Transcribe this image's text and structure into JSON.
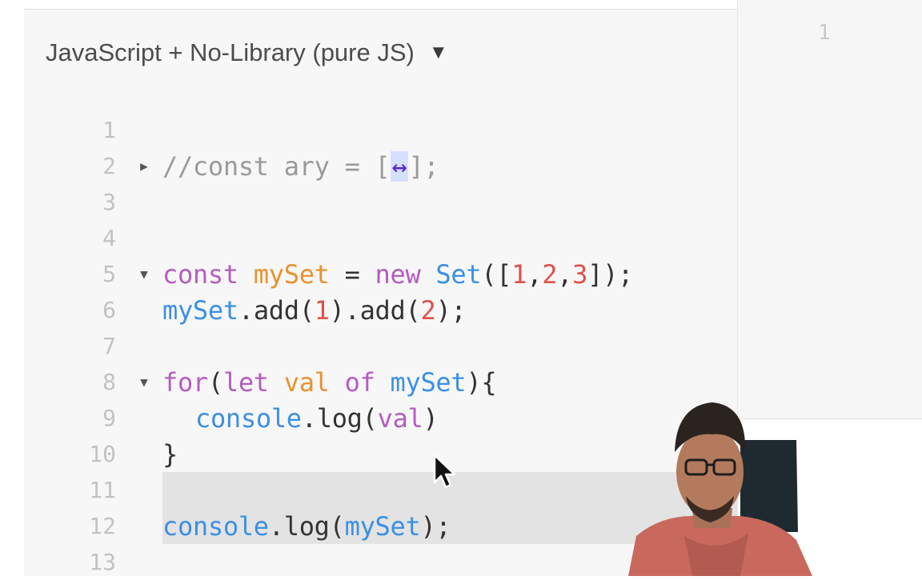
{
  "language_selector": {
    "label": "JavaScript + No-Library (pure JS)"
  },
  "editor": {
    "lines": [
      {
        "n": "1",
        "fold": "",
        "tokens": []
      },
      {
        "n": "2",
        "fold": "right",
        "tokens": [
          {
            "t": "//const ary = [",
            "c": "c"
          },
          {
            "t": "↔",
            "c": "blue-arrows"
          },
          {
            "t": "];",
            "c": "c"
          }
        ]
      },
      {
        "n": "3",
        "fold": "",
        "tokens": []
      },
      {
        "n": "4",
        "fold": "",
        "tokens": []
      },
      {
        "n": "5",
        "fold": "down",
        "tokens": [
          {
            "t": "const ",
            "c": "k"
          },
          {
            "t": "mySet",
            "c": "v"
          },
          {
            "t": " = ",
            "c": "p"
          },
          {
            "t": "new ",
            "c": "k"
          },
          {
            "t": "Set",
            "c": "fn"
          },
          {
            "t": "([",
            "c": "p"
          },
          {
            "t": "1",
            "c": "n"
          },
          {
            "t": ",",
            "c": "p"
          },
          {
            "t": "2",
            "c": "n"
          },
          {
            "t": ",",
            "c": "p"
          },
          {
            "t": "3",
            "c": "n"
          },
          {
            "t": "]);",
            "c": "p"
          }
        ]
      },
      {
        "n": "6",
        "fold": "",
        "tokens": [
          {
            "t": "mySet",
            "c": "fn"
          },
          {
            "t": ".",
            "c": "p"
          },
          {
            "t": "add",
            "c": "p"
          },
          {
            "t": "(",
            "c": "p"
          },
          {
            "t": "1",
            "c": "n"
          },
          {
            "t": ").",
            "c": "p"
          },
          {
            "t": "add",
            "c": "p"
          },
          {
            "t": "(",
            "c": "p"
          },
          {
            "t": "2",
            "c": "n"
          },
          {
            "t": ");",
            "c": "p"
          }
        ]
      },
      {
        "n": "7",
        "fold": "",
        "tokens": []
      },
      {
        "n": "8",
        "fold": "down",
        "tokens": [
          {
            "t": "for",
            "c": "k"
          },
          {
            "t": "(",
            "c": "p"
          },
          {
            "t": "let ",
            "c": "k"
          },
          {
            "t": "val ",
            "c": "v"
          },
          {
            "t": "of ",
            "c": "k"
          },
          {
            "t": "mySet",
            "c": "fn"
          },
          {
            "t": "){",
            "c": "p"
          }
        ]
      },
      {
        "n": "9",
        "fold": "",
        "indent": true,
        "tokens": [
          {
            "t": "console",
            "c": "fn"
          },
          {
            "t": ".",
            "c": "p"
          },
          {
            "t": "log",
            "c": "p"
          },
          {
            "t": "(",
            "c": "p"
          },
          {
            "t": "val",
            "c": "vb"
          },
          {
            "t": ")",
            "c": "p"
          }
        ]
      },
      {
        "n": "10",
        "fold": "",
        "tokens": [
          {
            "t": "}",
            "c": "p"
          }
        ]
      },
      {
        "n": "11",
        "fold": "",
        "highlight": true,
        "tokens": []
      },
      {
        "n": "12",
        "fold": "",
        "highlight": true,
        "tokens": [
          {
            "t": "console",
            "c": "fn"
          },
          {
            "t": ".",
            "c": "p"
          },
          {
            "t": "log",
            "c": "p"
          },
          {
            "t": "(",
            "c": "p"
          },
          {
            "t": "mySet",
            "c": "fn"
          },
          {
            "t": ");",
            "c": "p"
          }
        ]
      },
      {
        "n": "13",
        "fold": "",
        "tokens": []
      }
    ]
  },
  "output_panel": {
    "line_number": "1"
  },
  "icons": {
    "dropdown": "caret-down-icon",
    "cursor": "mouse-pointer-icon"
  }
}
